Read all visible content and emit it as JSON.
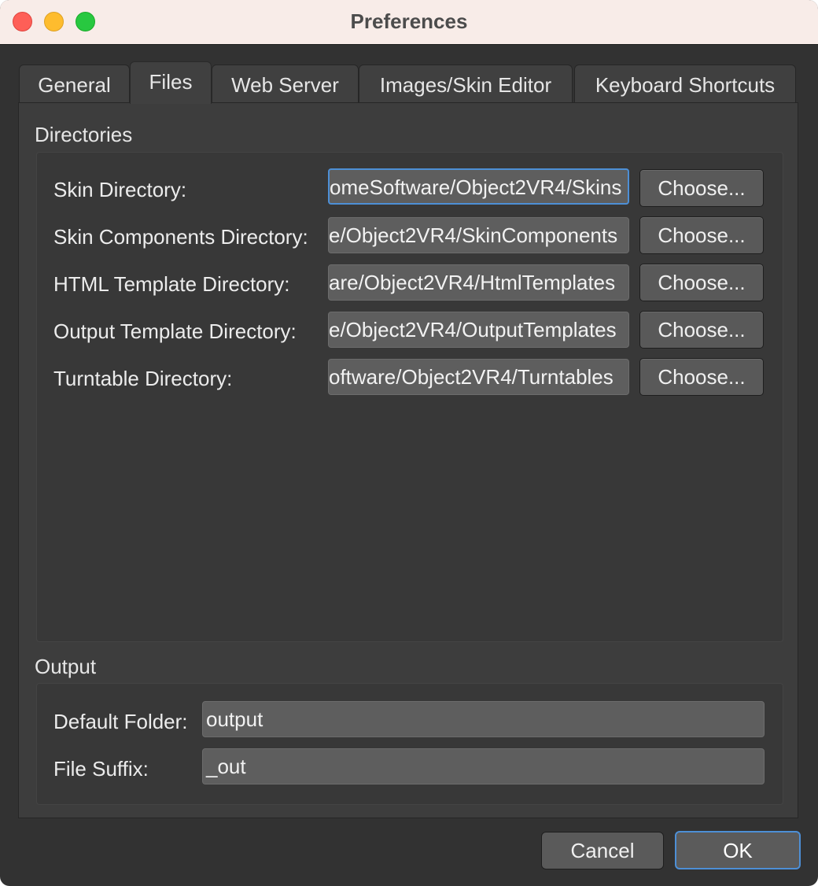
{
  "window": {
    "title": "Preferences"
  },
  "tabs": [
    {
      "label": "General"
    },
    {
      "label": "Files"
    },
    {
      "label": "Web Server"
    },
    {
      "label": "Images/Skin Editor"
    },
    {
      "label": "Keyboard Shortcuts"
    }
  ],
  "directories": {
    "title": "Directories",
    "rows": [
      {
        "label": "Skin Directory:",
        "value": "omeSoftware/Object2VR4/Skins",
        "button": "Choose..."
      },
      {
        "label": "Skin Components Directory:",
        "value": "e/Object2VR4/SkinComponents",
        "button": "Choose..."
      },
      {
        "label": "HTML Template Directory:",
        "value": "are/Object2VR4/HtmlTemplates",
        "button": "Choose..."
      },
      {
        "label": "Output Template Directory:",
        "value": "e/Object2VR4/OutputTemplates",
        "button": "Choose..."
      },
      {
        "label": "Turntable Directory:",
        "value": "oftware/Object2VR4/Turntables",
        "button": "Choose..."
      }
    ]
  },
  "output": {
    "title": "Output",
    "default_folder_label": "Default Folder:",
    "default_folder_value": "output",
    "file_suffix_label": "File Suffix:",
    "file_suffix_value": "_out"
  },
  "buttons": {
    "cancel": "Cancel",
    "ok": "OK"
  },
  "colors": {
    "accent": "#4d8fd6",
    "window_bg": "#323232",
    "titlebar_bg": "#f8ece8"
  }
}
